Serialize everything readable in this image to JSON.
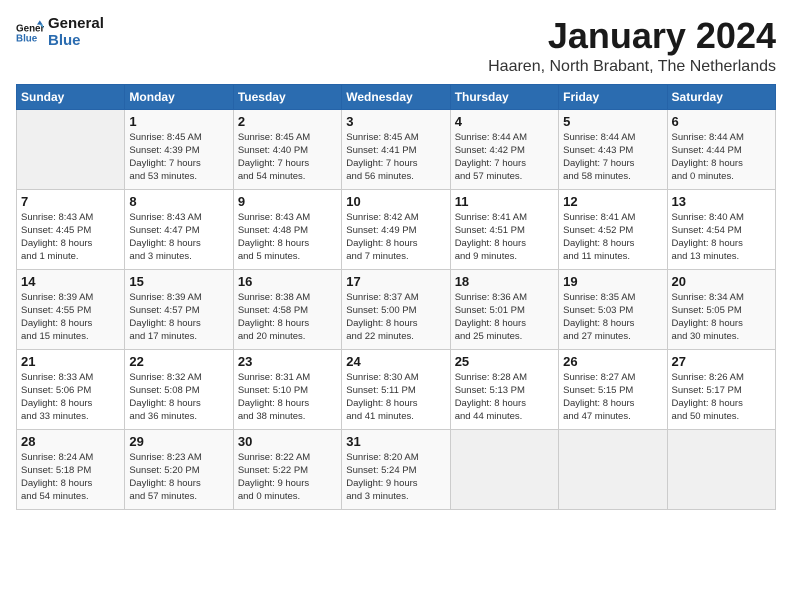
{
  "logo": {
    "line1": "General",
    "line2": "Blue"
  },
  "title": "January 2024",
  "location": "Haaren, North Brabant, The Netherlands",
  "days_header": [
    "Sunday",
    "Monday",
    "Tuesday",
    "Wednesday",
    "Thursday",
    "Friday",
    "Saturday"
  ],
  "weeks": [
    [
      {
        "day": "",
        "info": ""
      },
      {
        "day": "1",
        "info": "Sunrise: 8:45 AM\nSunset: 4:39 PM\nDaylight: 7 hours\nand 53 minutes."
      },
      {
        "day": "2",
        "info": "Sunrise: 8:45 AM\nSunset: 4:40 PM\nDaylight: 7 hours\nand 54 minutes."
      },
      {
        "day": "3",
        "info": "Sunrise: 8:45 AM\nSunset: 4:41 PM\nDaylight: 7 hours\nand 56 minutes."
      },
      {
        "day": "4",
        "info": "Sunrise: 8:44 AM\nSunset: 4:42 PM\nDaylight: 7 hours\nand 57 minutes."
      },
      {
        "day": "5",
        "info": "Sunrise: 8:44 AM\nSunset: 4:43 PM\nDaylight: 7 hours\nand 58 minutes."
      },
      {
        "day": "6",
        "info": "Sunrise: 8:44 AM\nSunset: 4:44 PM\nDaylight: 8 hours\nand 0 minutes."
      }
    ],
    [
      {
        "day": "7",
        "info": "Sunrise: 8:43 AM\nSunset: 4:45 PM\nDaylight: 8 hours\nand 1 minute."
      },
      {
        "day": "8",
        "info": "Sunrise: 8:43 AM\nSunset: 4:47 PM\nDaylight: 8 hours\nand 3 minutes."
      },
      {
        "day": "9",
        "info": "Sunrise: 8:43 AM\nSunset: 4:48 PM\nDaylight: 8 hours\nand 5 minutes."
      },
      {
        "day": "10",
        "info": "Sunrise: 8:42 AM\nSunset: 4:49 PM\nDaylight: 8 hours\nand 7 minutes."
      },
      {
        "day": "11",
        "info": "Sunrise: 8:41 AM\nSunset: 4:51 PM\nDaylight: 8 hours\nand 9 minutes."
      },
      {
        "day": "12",
        "info": "Sunrise: 8:41 AM\nSunset: 4:52 PM\nDaylight: 8 hours\nand 11 minutes."
      },
      {
        "day": "13",
        "info": "Sunrise: 8:40 AM\nSunset: 4:54 PM\nDaylight: 8 hours\nand 13 minutes."
      }
    ],
    [
      {
        "day": "14",
        "info": "Sunrise: 8:39 AM\nSunset: 4:55 PM\nDaylight: 8 hours\nand 15 minutes."
      },
      {
        "day": "15",
        "info": "Sunrise: 8:39 AM\nSunset: 4:57 PM\nDaylight: 8 hours\nand 17 minutes."
      },
      {
        "day": "16",
        "info": "Sunrise: 8:38 AM\nSunset: 4:58 PM\nDaylight: 8 hours\nand 20 minutes."
      },
      {
        "day": "17",
        "info": "Sunrise: 8:37 AM\nSunset: 5:00 PM\nDaylight: 8 hours\nand 22 minutes."
      },
      {
        "day": "18",
        "info": "Sunrise: 8:36 AM\nSunset: 5:01 PM\nDaylight: 8 hours\nand 25 minutes."
      },
      {
        "day": "19",
        "info": "Sunrise: 8:35 AM\nSunset: 5:03 PM\nDaylight: 8 hours\nand 27 minutes."
      },
      {
        "day": "20",
        "info": "Sunrise: 8:34 AM\nSunset: 5:05 PM\nDaylight: 8 hours\nand 30 minutes."
      }
    ],
    [
      {
        "day": "21",
        "info": "Sunrise: 8:33 AM\nSunset: 5:06 PM\nDaylight: 8 hours\nand 33 minutes."
      },
      {
        "day": "22",
        "info": "Sunrise: 8:32 AM\nSunset: 5:08 PM\nDaylight: 8 hours\nand 36 minutes."
      },
      {
        "day": "23",
        "info": "Sunrise: 8:31 AM\nSunset: 5:10 PM\nDaylight: 8 hours\nand 38 minutes."
      },
      {
        "day": "24",
        "info": "Sunrise: 8:30 AM\nSunset: 5:11 PM\nDaylight: 8 hours\nand 41 minutes."
      },
      {
        "day": "25",
        "info": "Sunrise: 8:28 AM\nSunset: 5:13 PM\nDaylight: 8 hours\nand 44 minutes."
      },
      {
        "day": "26",
        "info": "Sunrise: 8:27 AM\nSunset: 5:15 PM\nDaylight: 8 hours\nand 47 minutes."
      },
      {
        "day": "27",
        "info": "Sunrise: 8:26 AM\nSunset: 5:17 PM\nDaylight: 8 hours\nand 50 minutes."
      }
    ],
    [
      {
        "day": "28",
        "info": "Sunrise: 8:24 AM\nSunset: 5:18 PM\nDaylight: 8 hours\nand 54 minutes."
      },
      {
        "day": "29",
        "info": "Sunrise: 8:23 AM\nSunset: 5:20 PM\nDaylight: 8 hours\nand 57 minutes."
      },
      {
        "day": "30",
        "info": "Sunrise: 8:22 AM\nSunset: 5:22 PM\nDaylight: 9 hours\nand 0 minutes."
      },
      {
        "day": "31",
        "info": "Sunrise: 8:20 AM\nSunset: 5:24 PM\nDaylight: 9 hours\nand 3 minutes."
      },
      {
        "day": "",
        "info": ""
      },
      {
        "day": "",
        "info": ""
      },
      {
        "day": "",
        "info": ""
      }
    ]
  ]
}
